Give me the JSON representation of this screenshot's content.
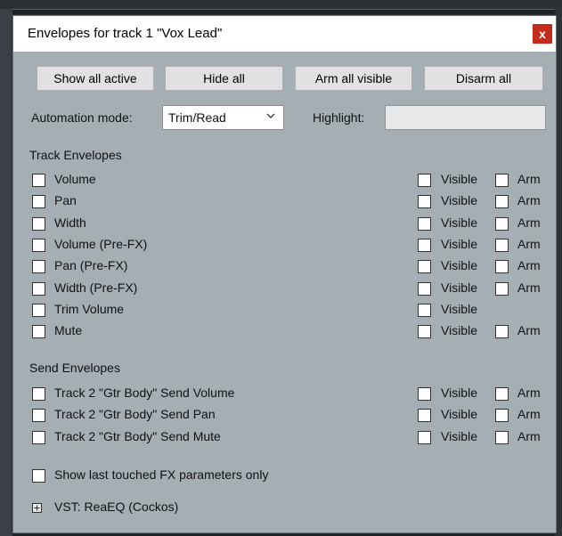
{
  "dialog": {
    "title": "Envelopes for track 1 \"Vox Lead\"",
    "close_label": "x"
  },
  "toolbar": {
    "show_all_active": "Show all active",
    "hide_all": "Hide all",
    "arm_all_visible": "Arm all visible",
    "disarm_all": "Disarm all"
  },
  "automation": {
    "label": "Automation mode:",
    "value": "Trim/Read",
    "highlight_label": "Highlight:",
    "highlight_value": ""
  },
  "track_envelopes": {
    "header": "Track Envelopes",
    "items": [
      {
        "label": "Volume",
        "visible_label": "Visible",
        "arm_label": "Arm"
      },
      {
        "label": "Pan",
        "visible_label": "Visible",
        "arm_label": "Arm"
      },
      {
        "label": "Width",
        "visible_label": "Visible",
        "arm_label": "Arm"
      },
      {
        "label": "Volume (Pre-FX)",
        "visible_label": "Visible",
        "arm_label": "Arm"
      },
      {
        "label": "Pan (Pre-FX)",
        "visible_label": "Visible",
        "arm_label": "Arm"
      },
      {
        "label": "Width (Pre-FX)",
        "visible_label": "Visible",
        "arm_label": "Arm"
      },
      {
        "label": "Trim Volume",
        "visible_label": "Visible",
        "arm_label": ""
      },
      {
        "label": "Mute",
        "visible_label": "Visible",
        "arm_label": "Arm"
      }
    ]
  },
  "send_envelopes": {
    "header": "Send Envelopes",
    "items": [
      {
        "label": "Track 2 \"Gtr Body\" Send Volume",
        "visible_label": "Visible",
        "arm_label": "Arm"
      },
      {
        "label": "Track 2 \"Gtr Body\" Send Pan",
        "visible_label": "Visible",
        "arm_label": "Arm"
      },
      {
        "label": "Track 2 \"Gtr Body\" Send Mute",
        "visible_label": "Visible",
        "arm_label": "Arm"
      }
    ]
  },
  "options": {
    "show_last_touched": "Show last touched FX parameters only"
  },
  "fx": {
    "expander": "⊞",
    "label": "VST: ReaEQ (Cockos)"
  }
}
